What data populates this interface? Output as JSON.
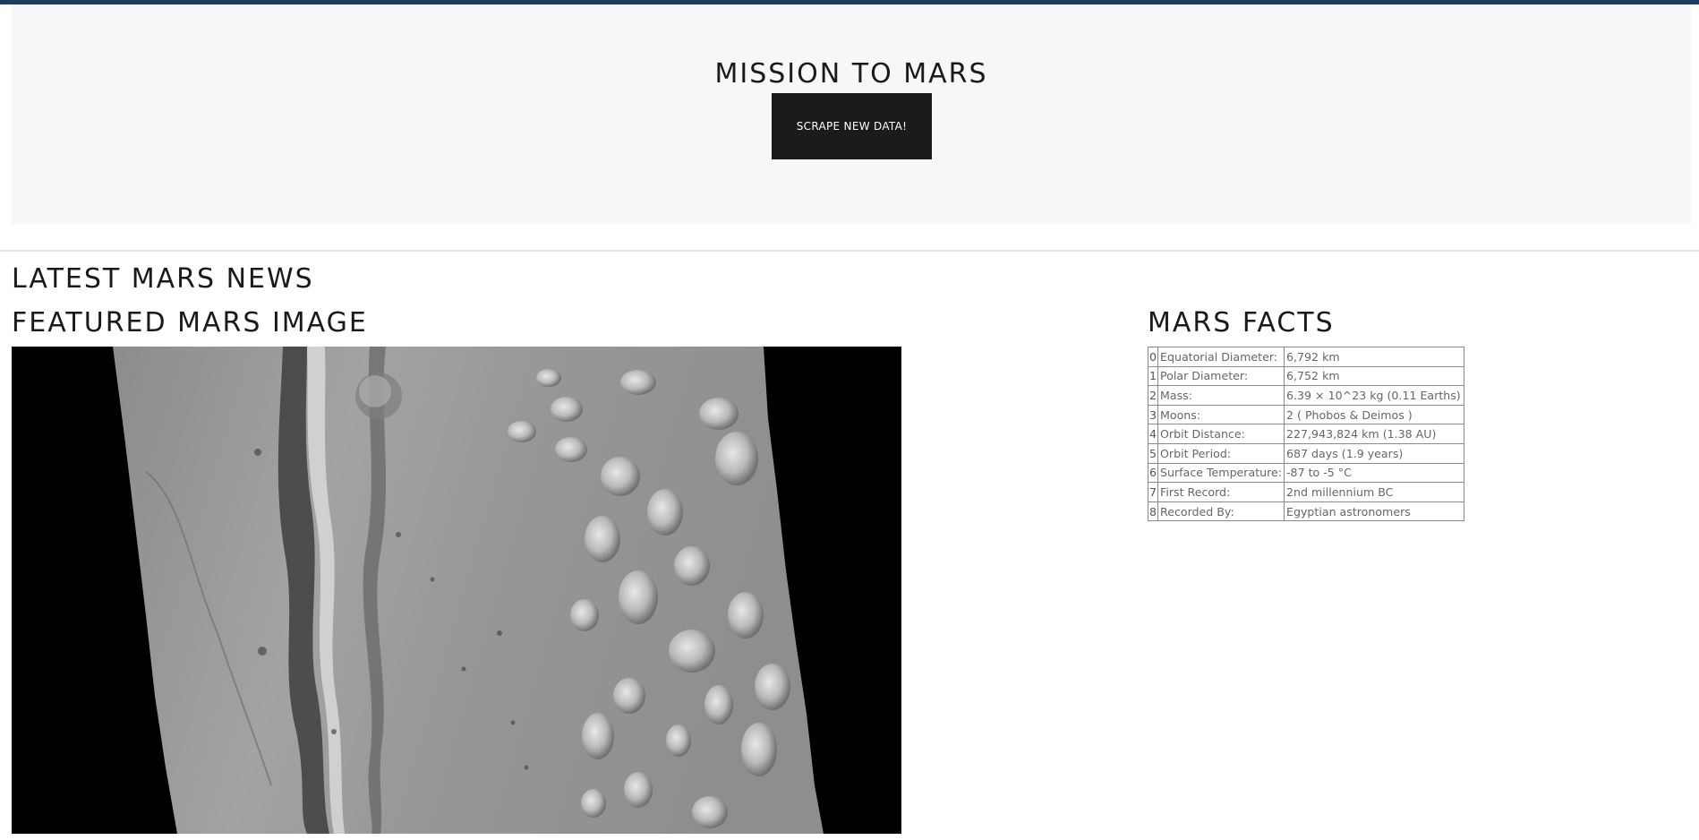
{
  "header": {
    "title": "MISSION TO MARS",
    "scrape_button": "SCRAPE NEW DATA!"
  },
  "news": {
    "heading": "LATEST MARS NEWS"
  },
  "featured_image": {
    "heading": "FEATURED MARS IMAGE"
  },
  "facts": {
    "heading": "MARS FACTS",
    "rows": [
      {
        "index": "0",
        "label": "Equatorial Diameter:",
        "value": "6,792 km"
      },
      {
        "index": "1",
        "label": "Polar Diameter:",
        "value": "6,752 km"
      },
      {
        "index": "2",
        "label": "Mass:",
        "value": "6.39 × 10^23 kg (0.11 Earths)"
      },
      {
        "index": "3",
        "label": "Moons:",
        "value": "2 ( Phobos & Deimos )"
      },
      {
        "index": "4",
        "label": "Orbit Distance:",
        "value": "227,943,824 km (1.38 AU)"
      },
      {
        "index": "5",
        "label": "Orbit Period:",
        "value": "687 days (1.9 years)"
      },
      {
        "index": "6",
        "label": "Surface Temperature:",
        "value": "-87 to -5 °C"
      },
      {
        "index": "7",
        "label": "First Record:",
        "value": "2nd millennium BC"
      },
      {
        "index": "8",
        "label": "Recorded By:",
        "value": "Egyptian astronomers"
      }
    ]
  }
}
